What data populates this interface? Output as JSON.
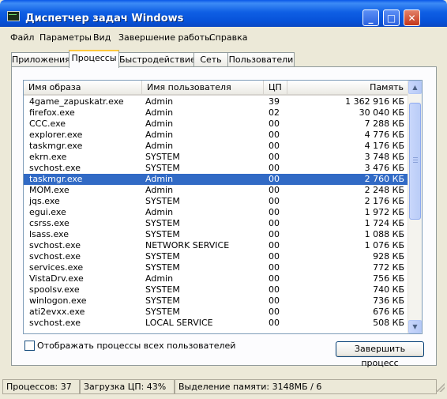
{
  "window": {
    "title": "Диспетчер задач Windows"
  },
  "menu": [
    "Файл",
    "Параметры",
    "Вид",
    "Завершение работы",
    "Справка"
  ],
  "tabs": [
    "Приложения",
    "Процессы",
    "Быстродействие",
    "Сеть",
    "Пользователи"
  ],
  "active_tab": "Процессы",
  "columns": {
    "name": "Имя образа",
    "user": "Имя пользователя",
    "cpu": "ЦП",
    "mem": "Память"
  },
  "processes": [
    {
      "name": "4game_zapuskatr.exe",
      "user": "Admin",
      "cpu": "39",
      "mem": "1 362 916 КБ"
    },
    {
      "name": "firefox.exe",
      "user": "Admin",
      "cpu": "02",
      "mem": "30 040 КБ"
    },
    {
      "name": "CCC.exe",
      "user": "Admin",
      "cpu": "00",
      "mem": "7 288 КБ"
    },
    {
      "name": "explorer.exe",
      "user": "Admin",
      "cpu": "00",
      "mem": "4 776 КБ"
    },
    {
      "name": "taskmgr.exe",
      "user": "Admin",
      "cpu": "00",
      "mem": "4 176 КБ"
    },
    {
      "name": "ekrn.exe",
      "user": "SYSTEM",
      "cpu": "00",
      "mem": "3 748 КБ"
    },
    {
      "name": "svchost.exe",
      "user": "SYSTEM",
      "cpu": "00",
      "mem": "3 476 КБ"
    },
    {
      "name": "taskmgr.exe",
      "user": "Admin",
      "cpu": "00",
      "mem": "2 760 КБ",
      "selected": true
    },
    {
      "name": "MOM.exe",
      "user": "Admin",
      "cpu": "00",
      "mem": "2 248 КБ"
    },
    {
      "name": "jqs.exe",
      "user": "SYSTEM",
      "cpu": "00",
      "mem": "2 176 КБ"
    },
    {
      "name": "egui.exe",
      "user": "Admin",
      "cpu": "00",
      "mem": "1 972 КБ"
    },
    {
      "name": "csrss.exe",
      "user": "SYSTEM",
      "cpu": "00",
      "mem": "1 724 КБ"
    },
    {
      "name": "lsass.exe",
      "user": "SYSTEM",
      "cpu": "00",
      "mem": "1 088 КБ"
    },
    {
      "name": "svchost.exe",
      "user": "NETWORK SERVICE",
      "cpu": "00",
      "mem": "1 076 КБ"
    },
    {
      "name": "svchost.exe",
      "user": "SYSTEM",
      "cpu": "00",
      "mem": "928 КБ"
    },
    {
      "name": "services.exe",
      "user": "SYSTEM",
      "cpu": "00",
      "mem": "772 КБ"
    },
    {
      "name": "VistaDrv.exe",
      "user": "Admin",
      "cpu": "00",
      "mem": "756 КБ"
    },
    {
      "name": "spoolsv.exe",
      "user": "SYSTEM",
      "cpu": "00",
      "mem": "740 КБ"
    },
    {
      "name": "winlogon.exe",
      "user": "SYSTEM",
      "cpu": "00",
      "mem": "736 КБ"
    },
    {
      "name": "ati2evxx.exe",
      "user": "SYSTEM",
      "cpu": "00",
      "mem": "676 КБ"
    },
    {
      "name": "svchost.exe",
      "user": "LOCAL SERVICE",
      "cpu": "00",
      "mem": "508 КБ"
    }
  ],
  "show_all_label": "Отображать процессы всех пользователей",
  "end_process_label": "Завершить процесс",
  "status": {
    "processes": "Процессов: 37",
    "cpu": "Загрузка ЦП: 43%",
    "memory": "Выделение памяти: 3148МБ / 6"
  },
  "colors": {
    "selection": "#316ac5",
    "titlebar": "#0a58e8",
    "window_bg": "#ece9d8"
  }
}
